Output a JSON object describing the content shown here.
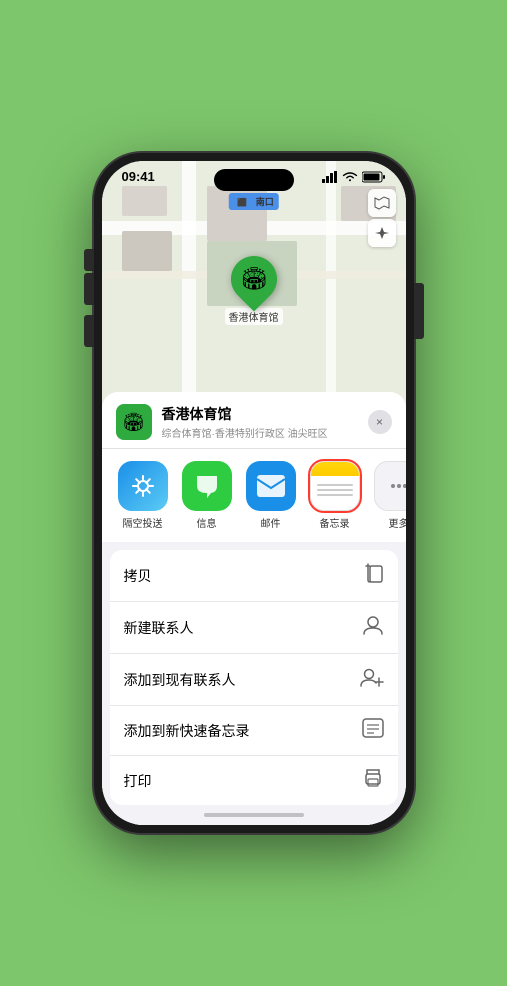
{
  "status_bar": {
    "time": "09:41",
    "signal_bars": "▌▌▌",
    "wifi": "WiFi",
    "battery": "Battery"
  },
  "map": {
    "label": "南口",
    "label_prefix": "⬛"
  },
  "location": {
    "name": "香港体育馆",
    "pin_emoji": "🏟"
  },
  "sheet": {
    "venue_name": "香港体育馆",
    "venue_sub": "综合体育馆·香港特别行政区 油尖旺区",
    "close_label": "×"
  },
  "share_items": [
    {
      "label": "隔空投送",
      "type": "airdrop",
      "icon": "📡"
    },
    {
      "label": "信息",
      "type": "message",
      "icon": "💬"
    },
    {
      "label": "邮件",
      "type": "mail",
      "icon": "✉️"
    },
    {
      "label": "备忘录",
      "type": "notes",
      "icon": "📝"
    },
    {
      "label": "更多",
      "type": "more",
      "icon": "···"
    }
  ],
  "actions": [
    {
      "label": "拷贝",
      "icon": "📋"
    },
    {
      "label": "新建联系人",
      "icon": "👤"
    },
    {
      "label": "添加到现有联系人",
      "icon": "👥"
    },
    {
      "label": "添加到新快速备忘录",
      "icon": "📝"
    },
    {
      "label": "打印",
      "icon": "🖨"
    }
  ]
}
